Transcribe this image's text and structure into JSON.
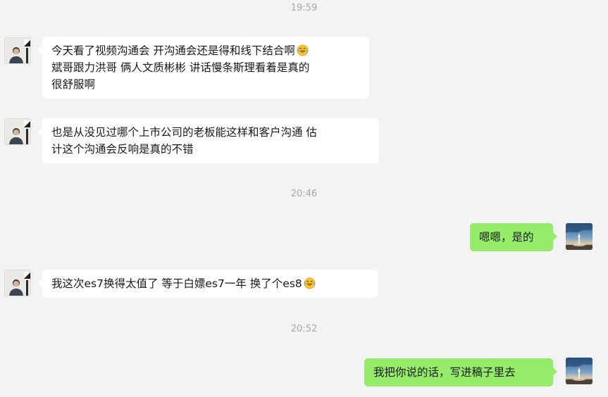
{
  "conversation": {
    "timestamps": [
      "19:59",
      "20:46",
      "20:52"
    ],
    "messages": [
      {
        "side": "left",
        "lines": [
          "今天看了视频沟通会 开沟通会还是得和线下结合啊",
          "斌哥跟力洪哥 俩人文质彬彬 讲话慢条斯理看着是真的",
          "很舒服啊"
        ],
        "emoji": "laughing-tears-emoji"
      },
      {
        "side": "left",
        "lines": [
          "也是从没见过哪个上市公司的老板能这样和客户沟通 估",
          "计这个沟通会反响是真的不错"
        ]
      },
      {
        "side": "right",
        "lines": [
          "嗯嗯，是的"
        ]
      },
      {
        "side": "left",
        "lines": [
          "我这次es7换得太值了 等于白嫖es7一年 换了个es8"
        ],
        "emoji": "laughing-tears-emoji"
      },
      {
        "side": "right",
        "lines": [
          "我把你说的话，写进稿子里去"
        ]
      }
    ]
  },
  "colors": {
    "background": "#f3f3f3",
    "incoming_bubble": "#ffffff",
    "outgoing_bubble": "#95ec69",
    "timestamp_text": "#a6a6a6"
  }
}
